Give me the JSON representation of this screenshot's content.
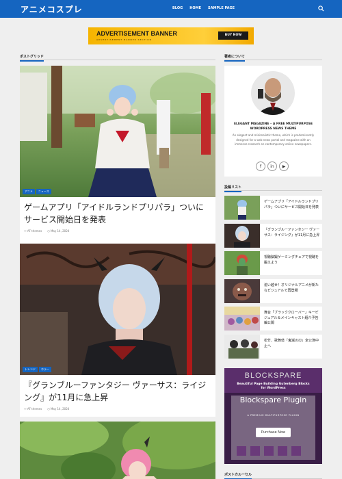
{
  "header": {
    "site_title": "アニメコスプレ",
    "nav": [
      "BLOG",
      "HOME",
      "SAMPLE PAGE"
    ]
  },
  "ad": {
    "title": "ADVERTISEMENT BANNER",
    "subtitle": "ADVERTISEMENT BANNER SECTION",
    "button": "BUY NOW"
  },
  "main": {
    "section_title": "ポストグリッド",
    "posts": [
      {
        "tags": [
          "アニメ",
          "ニュース"
        ],
        "title": "ゲームアプリ「アイドルランドプリパラ」ついにサービス開始日を発表",
        "author": "AF themes",
        "date": "May 14, 2024"
      },
      {
        "tags": [
          "トレンド",
          "ホラー"
        ],
        "title": "『グランブルーファンタジー ヴァーサス：ライジング』が11月に急上昇",
        "author": "AF themes",
        "date": "May 14, 2024"
      }
    ]
  },
  "sidebar": {
    "about_heading": "著者について",
    "about_title": "ELEGANT MAGAZINE – A FREE MULTIPURPOSE WORDPRESS NEWS THEME",
    "about_desc": "An elegant and minimalistic theme, which is predominantly designed for a web news portal and magazine with an immense research on contemporary online newspapers.",
    "socials": [
      "facebook-icon",
      "linkedin-icon",
      "youtube-icon"
    ],
    "list_heading": "投稿リスト",
    "list": [
      "ゲームアプリ「アイドルランドプリパラ」ついにサービス開始日を発表",
      "『グランブルーファンタジー ヴァーサス：ライジング』が11月に急上昇",
      "視聴脳鍛ゲーミングチェアで視聴を鍛えよう",
      "追い越せ！オリジナルアニメが新たなビジュアルで再登場",
      "舞台「ブラッククローバー」キービジュアル＆メインキャスト紹介予告編公開",
      "松竹、歌舞伎『鬼滅の刃』全公演中止へ"
    ],
    "promo": {
      "logo": "BLOCKSPARE",
      "subtitle": "Beautiful Page Building Gutenberg Blocks for WordPress",
      "name": "Blockspare Plugin",
      "premium": "A PREMIUM MULTIPURPOSE PLUGIN",
      "button": "Purchase Now"
    },
    "carousel_heading": "ポストカルーセル"
  },
  "colors": {
    "accent": "#1565c0",
    "ad_yellow": "#ffcf3a"
  }
}
